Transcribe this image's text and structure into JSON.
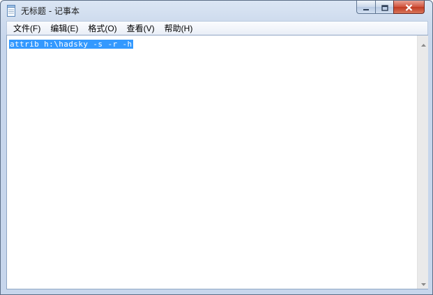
{
  "window": {
    "title": "无标题 - 记事本"
  },
  "menu": [
    {
      "label": "文件(F)"
    },
    {
      "label": "编辑(E)"
    },
    {
      "label": "格式(O)"
    },
    {
      "label": "查看(V)"
    },
    {
      "label": "帮助(H)"
    }
  ],
  "editor": {
    "content": "attrib h:\\hadsky -s -r -h",
    "selection_color": "#3399ff"
  },
  "icons": {
    "app": "notepad-icon",
    "minimize": "minimize-icon",
    "maximize": "maximize-icon",
    "close": "close-icon",
    "scroll_up": "scroll-up-arrow-icon",
    "scroll_down": "scroll-down-arrow-icon"
  },
  "colors": {
    "close_button": "#c13a22",
    "titlebar": "#cfdcee"
  }
}
